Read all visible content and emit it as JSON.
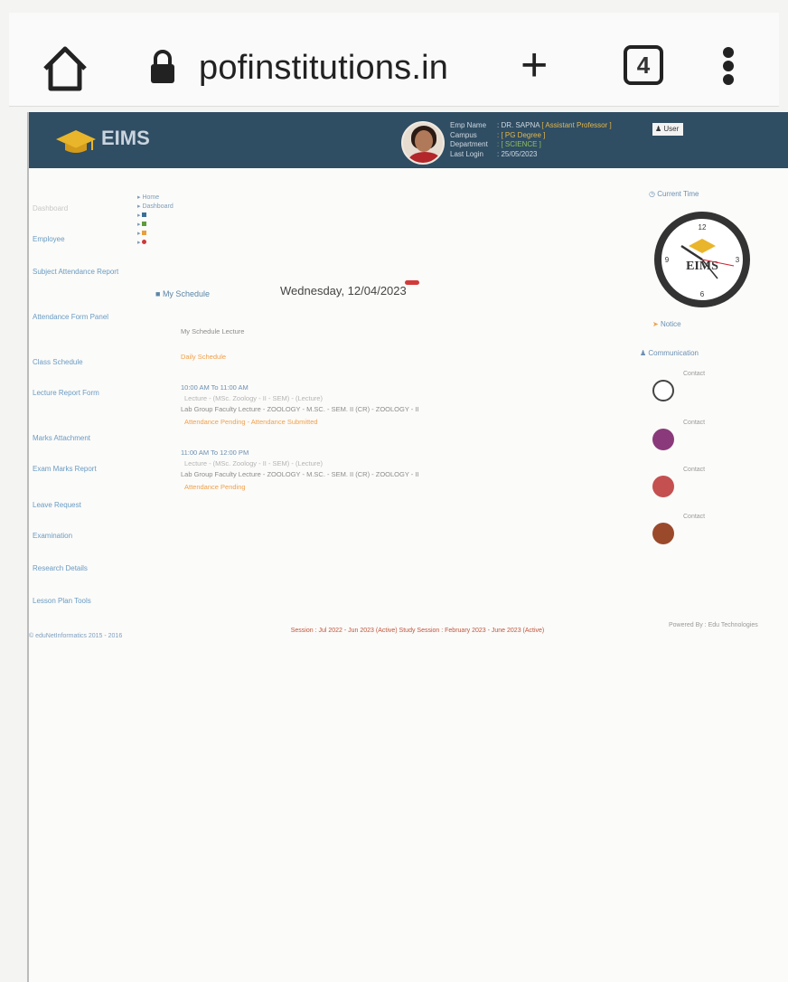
{
  "browser": {
    "url": "pofinstitutions.in",
    "tab_count": "4",
    "icons": [
      "home-icon",
      "lock-icon",
      "new-tab-icon",
      "tabs-icon",
      "more-menu-icon"
    ]
  },
  "header": {
    "logo_text": "EIMS",
    "user": {
      "emp_name_label": "Emp Name",
      "emp_name": ": DR. SAPNA",
      "designation": "[ Assistant Professor ]",
      "campus_label": "Campus",
      "campus": ": [ PG Degree ]",
      "department_label": "Department",
      "department": ": [ SCIENCE ]",
      "last_login_label": "Last Login",
      "last_login": ": 25/05/2023"
    },
    "user_button": "User"
  },
  "sidebar": {
    "items": [
      {
        "label": "Dashboard",
        "dim": true
      },
      {
        "label": "Employee"
      },
      {
        "label": "Subject Attendance Report"
      },
      {
        "label": "Attendance Form Panel"
      },
      {
        "label": "Class Schedule"
      },
      {
        "label": "Lecture Report Form"
      },
      {
        "label": "Marks Attachment"
      },
      {
        "label": "Exam Marks Report"
      },
      {
        "label": "Leave Request"
      },
      {
        "label": "Examination"
      },
      {
        "label": "Research Details"
      },
      {
        "label": "Lesson Plan Tools"
      }
    ]
  },
  "breadcrumbs": [
    "Home",
    "Dashboard"
  ],
  "main": {
    "schedule_label": "My Schedule",
    "date": "Wednesday, 12/04/2023",
    "lines": [
      "My Schedule Lecture",
      "Daily Schedule",
      "10:00 AM To 11:00 AM",
      "Lecture - (MSc. Zoology - II - SEM) - (Lecture)",
      "Lab Group Faculty Lecture - ZOOLOGY - M.SC. - SEM. II (CR) - ZOOLOGY - II",
      "Attendance Pending - Attendance Submitted",
      "11:00 AM To 12:00 PM",
      "Lecture - (MSc. Zoology - II - SEM) - (Lecture)",
      "Lab Group Faculty Lecture - ZOOLOGY - M.SC. - SEM. II (CR) - ZOOLOGY - II",
      "Attendance Pending"
    ]
  },
  "right_panel": {
    "clock_title": "Current Time",
    "clock_brand": "EIMS",
    "notice_label": "Notice",
    "comm_label": "Communication",
    "contacts": [
      {
        "name": "Contact"
      },
      {
        "name": "Contact"
      },
      {
        "name": "Contact"
      },
      {
        "name": "Contact"
      }
    ]
  },
  "footer": {
    "left": "© eduNetInformatics 2015 - 2016",
    "session": "Session : Jul 2022 - Jun 2023 (Active)  Study Session : February 2023 - June 2023 (Active)",
    "right": "Powered By : Edu Technologies"
  },
  "colors": {
    "topbar": "#2f4d63",
    "link": "#6a9bc3",
    "accent_orange": "#f0a04b",
    "accent_red": "#d23a3a"
  }
}
